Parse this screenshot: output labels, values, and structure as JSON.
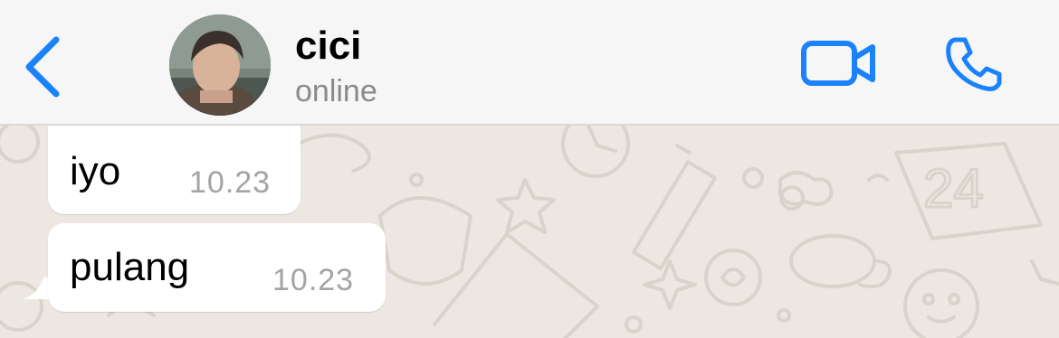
{
  "header": {
    "contact_name": "cici",
    "status": "online"
  },
  "icons": {
    "back": "chevron-left-icon",
    "video": "video-camera-icon",
    "call": "phone-icon"
  },
  "colors": {
    "accent": "#1a82fb",
    "bubble": "#ffffff",
    "timestamp": "#a4a4a8",
    "wallpaper": "#ece8e1"
  },
  "messages": [
    {
      "text": "iyo",
      "time": "10.23"
    },
    {
      "text": "pulang",
      "time": "10.23"
    }
  ]
}
